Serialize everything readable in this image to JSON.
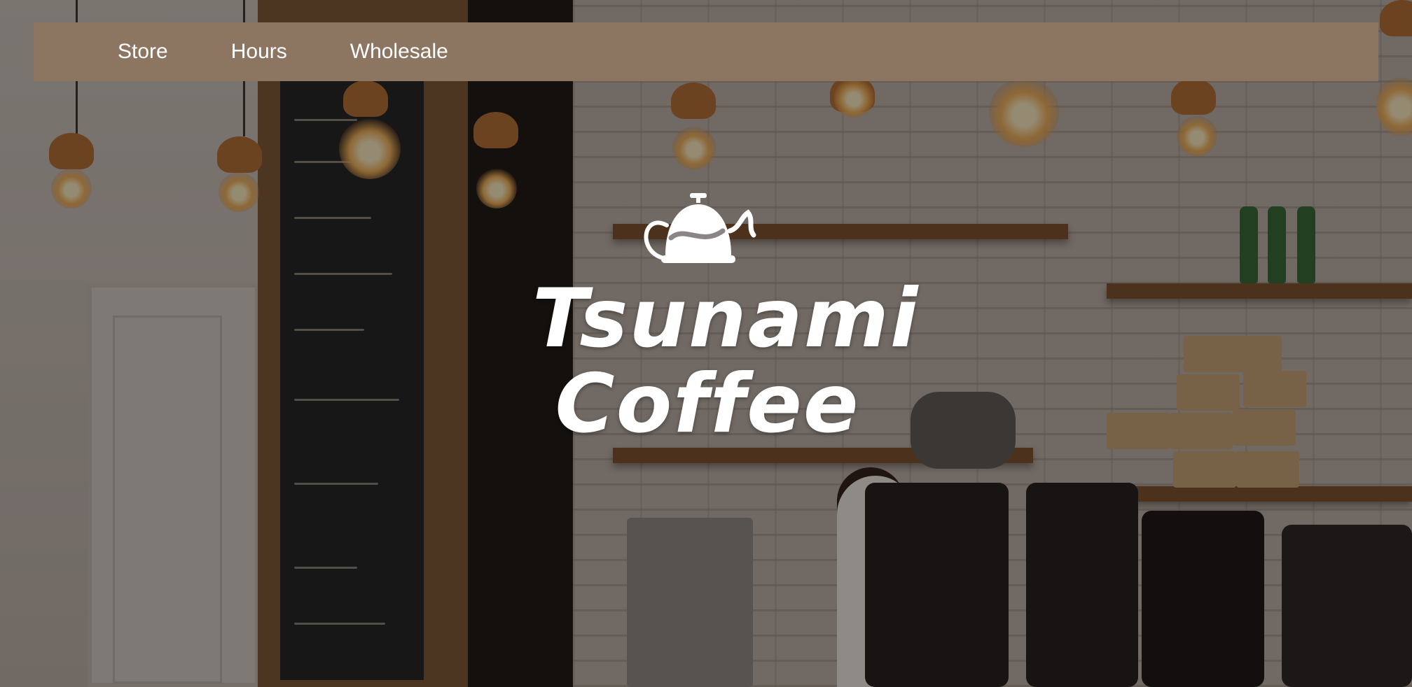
{
  "nav": {
    "items": [
      {
        "label": "Store"
      },
      {
        "label": "Hours"
      },
      {
        "label": "Wholesale"
      }
    ],
    "background": "#8c7561",
    "text_color": "#ffffff"
  },
  "hero": {
    "logo_icon": "kettle-icon",
    "brand_line1": "Tsunami",
    "brand_line2": "Coffee",
    "background_image": "cafe-interior-photo"
  }
}
